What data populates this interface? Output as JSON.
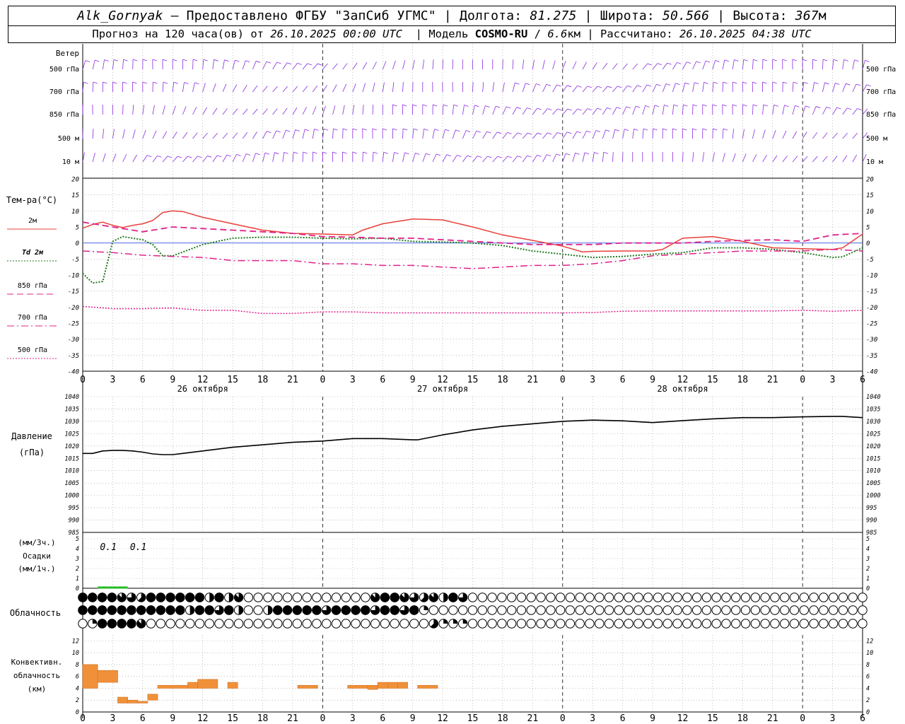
{
  "header": {
    "station": "Alk_Gornyak",
    "provider": "– Предоставлено ФГБУ \"ЗапСиб УГМС\"",
    "lon_label": "Долгота:",
    "lon": "81.275",
    "lat_label": "Широта:",
    "lat": "50.566",
    "alt_label": "Высота:",
    "alt": "367",
    "alt_unit": "м",
    "forecast_prefix": "Прогноз на 120 часа(ов) от",
    "forecast_start": "26.10.2025 00:00 UTC",
    "model_label": "Модель",
    "model": "COSMO-RU",
    "resolution": "6.6",
    "resolution_unit": "км",
    "computed_label": "Рассчитано:",
    "computed": "26.10.2025 04:38 UTC"
  },
  "panels": {
    "wind": {
      "title": "Ветер",
      "levels": [
        "500 гПа",
        "700 гПа",
        "850 гПа",
        "500 м",
        "10 м"
      ]
    },
    "temperature": {
      "title": "Тем-ра(°C)",
      "legend": [
        "2м",
        "Td 2м",
        "850 гПа",
        "700 гПа",
        "500 гПа"
      ],
      "yticks": [
        20,
        15,
        10,
        5,
        0,
        -5,
        -10,
        -15,
        -20,
        -25,
        -30,
        -35,
        -40
      ]
    },
    "pressure": {
      "title": "Давление",
      "unit": "(гПа)",
      "yticks": [
        1040,
        1035,
        1030,
        1025,
        1020,
        1015,
        1010,
        1005,
        1000,
        995,
        990,
        985
      ]
    },
    "precip": {
      "title": "Осадки",
      "unit_top": "(мм/3ч.)",
      "unit_bottom": "(мм/1ч.)",
      "yticks": [
        5,
        4,
        3,
        2,
        1,
        0
      ],
      "labels": [
        {
          "hour": 3,
          "text": "0.1"
        },
        {
          "hour": 6,
          "text": "0.1"
        }
      ],
      "bars_1h_hours": [
        2,
        3,
        4
      ]
    },
    "cloud": {
      "title": "Облачность",
      "rows": [
        [
          8,
          8,
          8,
          8,
          7,
          6,
          5,
          8,
          8,
          8,
          8,
          8,
          8,
          4,
          8,
          4,
          7,
          0,
          0,
          0,
          0,
          0,
          0,
          0,
          0,
          0,
          0,
          0,
          0,
          0,
          7,
          8,
          8,
          7,
          6,
          5,
          7,
          4,
          8,
          6,
          0,
          0,
          0,
          0,
          0,
          0,
          0,
          0,
          0,
          0,
          0,
          0,
          0,
          0,
          0,
          0,
          0,
          0,
          0,
          0,
          0,
          0,
          0,
          0,
          0,
          0,
          0,
          0,
          0,
          0,
          0,
          0,
          0,
          0,
          0,
          0,
          0,
          0,
          0,
          0,
          0
        ],
        [
          8,
          8,
          8,
          8,
          8,
          8,
          8,
          8,
          8,
          8,
          8,
          4,
          8,
          8,
          6,
          8,
          4,
          0,
          0,
          4,
          8,
          8,
          8,
          8,
          8,
          6,
          8,
          8,
          8,
          8,
          6,
          8,
          8,
          6,
          8,
          2,
          0,
          0,
          0,
          0,
          0,
          0,
          0,
          0,
          0,
          0,
          0,
          0,
          0,
          0,
          0,
          0,
          0,
          0,
          0,
          0,
          0,
          0,
          0,
          0,
          0,
          0,
          0,
          0,
          0,
          0,
          0,
          0,
          0,
          0,
          0,
          0,
          0,
          0,
          0,
          0,
          0,
          0,
          0,
          0,
          0
        ],
        [
          0,
          2,
          8,
          8,
          8,
          8,
          7,
          0,
          0,
          0,
          0,
          0,
          0,
          0,
          0,
          0,
          0,
          0,
          0,
          0,
          0,
          0,
          0,
          0,
          0,
          0,
          0,
          0,
          0,
          0,
          0,
          0,
          0,
          0,
          0,
          0,
          5,
          2,
          2,
          2,
          0,
          0,
          0,
          0,
          0,
          0,
          0,
          0,
          0,
          0,
          0,
          0,
          0,
          0,
          0,
          0,
          0,
          0,
          0,
          0,
          0,
          0,
          0,
          0,
          0,
          0,
          0,
          0,
          0,
          0,
          0,
          0,
          0,
          0,
          0,
          0,
          0,
          0,
          0,
          0,
          0
        ]
      ]
    },
    "convective": {
      "title_lines": [
        "Конвективн.",
        "облачность",
        "(км)"
      ],
      "yticks": [
        12,
        10,
        8,
        6,
        4,
        2,
        0
      ],
      "bars": [
        [
          0,
          1.5,
          4,
          8
        ],
        [
          1.5,
          3.5,
          5,
          7
        ],
        [
          3.5,
          4.5,
          1.5,
          2.5
        ],
        [
          4.5,
          5.5,
          1.5,
          2
        ],
        [
          5.5,
          6.5,
          1.5,
          1.8
        ],
        [
          6.5,
          7.5,
          2,
          3
        ],
        [
          7.5,
          10.5,
          4,
          4.5
        ],
        [
          10.5,
          11.5,
          4,
          5
        ],
        [
          11.5,
          13.5,
          4,
          5.5
        ],
        [
          14.5,
          15.5,
          4,
          5
        ],
        [
          21.5,
          23.5,
          4,
          4.5
        ],
        [
          26.5,
          28.5,
          4,
          4.5
        ],
        [
          28.5,
          29.5,
          3.8,
          4.5
        ],
        [
          29.5,
          30.5,
          4,
          5
        ],
        [
          30.5,
          31.5,
          4,
          5
        ],
        [
          31.5,
          32.5,
          4,
          5
        ],
        [
          33.5,
          35.5,
          4,
          4.5
        ]
      ]
    }
  },
  "xaxis": {
    "tick_labels": [
      "0",
      "3",
      "6",
      "9",
      "12",
      "15",
      "18",
      "21",
      "0",
      "3",
      "6",
      "9",
      "12",
      "15",
      "18",
      "21",
      "0",
      "3",
      "6",
      "9",
      "12",
      "15",
      "18",
      "21",
      "0",
      "3",
      "6"
    ],
    "days": [
      {
        "hour": 12,
        "label": "26 октября"
      },
      {
        "hour": 36,
        "label": "27 октября"
      },
      {
        "hour": 60,
        "label": "28 октября"
      }
    ],
    "day_boundaries": [
      24,
      48,
      72
    ]
  },
  "chart_data": [
    {
      "type": "line",
      "title": "Тем-ра(°C)",
      "ylim": [
        -40,
        20
      ],
      "series": [
        {
          "name": "2м",
          "color": "#e8403a",
          "x": [
            0,
            1,
            2,
            3,
            4,
            5,
            6,
            7,
            8,
            9,
            10,
            12,
            15,
            18,
            21,
            24,
            27,
            28,
            29,
            30,
            33,
            36,
            39,
            42,
            45,
            48,
            50,
            51,
            54,
            57,
            58,
            60,
            63,
            66,
            69,
            72,
            75,
            76,
            78
          ],
          "values": [
            4.6,
            5.8,
            6.5,
            5.5,
            4.8,
            5.5,
            6.0,
            7.0,
            9.5,
            10.0,
            9.8,
            8.0,
            6.0,
            4.0,
            3.0,
            2.8,
            2.5,
            4.0,
            5.0,
            6.0,
            7.5,
            7.2,
            5.0,
            2.5,
            0.8,
            -1.0,
            -2.8,
            -2.6,
            -2.5,
            -2.5,
            -2.0,
            1.5,
            2.0,
            0.5,
            -1.5,
            -1.8,
            -2.0,
            -1.5,
            2.8
          ]
        },
        {
          "name": "Td 2м",
          "color": "#1f7a1f",
          "x": [
            0,
            1,
            2,
            3,
            4,
            5,
            6,
            7,
            8,
            9,
            12,
            15,
            18,
            21,
            24,
            27,
            30,
            33,
            36,
            39,
            42,
            45,
            48,
            51,
            54,
            57,
            60,
            63,
            66,
            69,
            72,
            75,
            76,
            78
          ],
          "values": [
            -9.5,
            -12.5,
            -12.0,
            0.5,
            2.0,
            1.5,
            1.0,
            -0.5,
            -4.0,
            -4.0,
            -0.5,
            1.5,
            1.8,
            1.8,
            1.5,
            1.3,
            1.5,
            0.5,
            0.3,
            0.0,
            -0.8,
            -2.5,
            -3.5,
            -4.5,
            -4.2,
            -3.5,
            -3.0,
            -1.5,
            -1.5,
            -2.0,
            -3.0,
            -4.5,
            -4.3,
            -1.5
          ]
        },
        {
          "name": "850 гПа",
          "color": "#e0218a",
          "x": [
            0,
            3,
            6,
            9,
            12,
            15,
            18,
            21,
            24,
            27,
            30,
            33,
            36,
            39,
            42,
            45,
            48,
            51,
            54,
            57,
            60,
            63,
            66,
            69,
            72,
            75,
            78
          ],
          "values": [
            6.5,
            5.0,
            3.5,
            5.0,
            4.5,
            4.0,
            3.5,
            3.0,
            2.0,
            1.8,
            1.5,
            1.5,
            1.0,
            0.5,
            0.0,
            -0.5,
            -0.5,
            -0.5,
            0.0,
            0.0,
            0.0,
            0.5,
            0.8,
            1.0,
            0.5,
            2.5,
            3.0
          ]
        },
        {
          "name": "700 гПа",
          "color": "#e0218a",
          "x": [
            0,
            3,
            6,
            9,
            12,
            15,
            18,
            21,
            24,
            27,
            30,
            33,
            36,
            39,
            42,
            45,
            48,
            51,
            54,
            57,
            60,
            63,
            66,
            69,
            72,
            75,
            78
          ],
          "values": [
            -2.5,
            -3.0,
            -3.8,
            -4.2,
            -4.5,
            -5.5,
            -5.5,
            -5.5,
            -6.5,
            -6.5,
            -7.0,
            -7.0,
            -7.5,
            -8.0,
            -7.5,
            -7.0,
            -7.0,
            -6.5,
            -5.5,
            -4.0,
            -3.5,
            -3.0,
            -2.5,
            -2.5,
            -2.5,
            -2.0,
            -2.5
          ]
        },
        {
          "name": "500 гПа",
          "color": "#e0218a",
          "x": [
            0,
            3,
            6,
            9,
            12,
            15,
            18,
            21,
            24,
            27,
            30,
            33,
            36,
            39,
            42,
            45,
            48,
            51,
            54,
            57,
            60,
            63,
            66,
            69,
            72,
            75,
            78
          ],
          "values": [
            -19.8,
            -20.5,
            -20.5,
            -20.3,
            -21.0,
            -21.0,
            -22.0,
            -22.0,
            -21.5,
            -21.5,
            -21.8,
            -21.8,
            -21.8,
            -21.8,
            -21.8,
            -21.8,
            -21.8,
            -21.7,
            -21.3,
            -21.2,
            -21.2,
            -21.2,
            -21.2,
            -21.2,
            -21.0,
            -21.3,
            -21.0
          ]
        }
      ]
    },
    {
      "type": "line",
      "title": "Давление",
      "ylim": [
        985,
        1040
      ],
      "series": [
        {
          "name": "Давление",
          "color": "#000000",
          "x": [
            0,
            1,
            2,
            3,
            4,
            5,
            6,
            7,
            8,
            9,
            10,
            12,
            14,
            15,
            18,
            21,
            24,
            27,
            30,
            33,
            33.5,
            36,
            39,
            42,
            45,
            48,
            51,
            54,
            57,
            60,
            63,
            66,
            69,
            72,
            75,
            76,
            78
          ],
          "values": [
            1017,
            1017,
            1018,
            1018.2,
            1018.2,
            1018,
            1017.5,
            1016.8,
            1016.5,
            1016.5,
            1017,
            1018,
            1019,
            1019.5,
            1020.5,
            1021.5,
            1022,
            1023,
            1023,
            1022.5,
            1022.5,
            1024.5,
            1026.5,
            1028,
            1029,
            1030,
            1030.5,
            1030.2,
            1029.5,
            1030.3,
            1031,
            1031.5,
            1031.5,
            1031.8,
            1032,
            1032,
            1031.5
          ]
        }
      ]
    }
  ]
}
